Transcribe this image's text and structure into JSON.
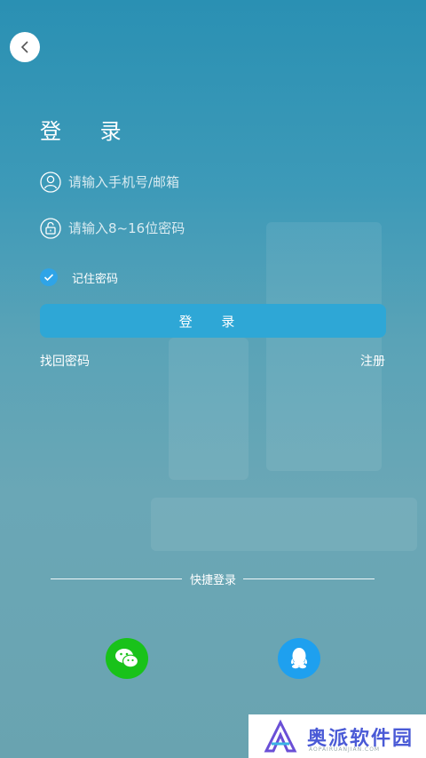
{
  "header": {
    "back_icon": "chevron-left-icon"
  },
  "title": "登  录",
  "fields": {
    "phone": {
      "placeholder": "请输入手机号/邮箱",
      "icon": "user-icon"
    },
    "password": {
      "placeholder": "请输入8~16位密码",
      "icon": "lock-icon"
    }
  },
  "remember": {
    "label": "记住密码",
    "checked": true
  },
  "login_button": "登 录",
  "links": {
    "forgot": "找回密码",
    "register": "注册"
  },
  "quick_login": {
    "label": "快捷登录",
    "wechat_icon": "wechat-icon",
    "qq_icon": "qq-icon"
  },
  "watermark": {
    "text": "奥派软件园",
    "sub": "AOPAIRUANJIAN.COM"
  },
  "colors": {
    "accent": "#2ea7d6",
    "check": "#2fa4e7",
    "wechat": "#19c21a",
    "qq": "#1ea0ef"
  }
}
